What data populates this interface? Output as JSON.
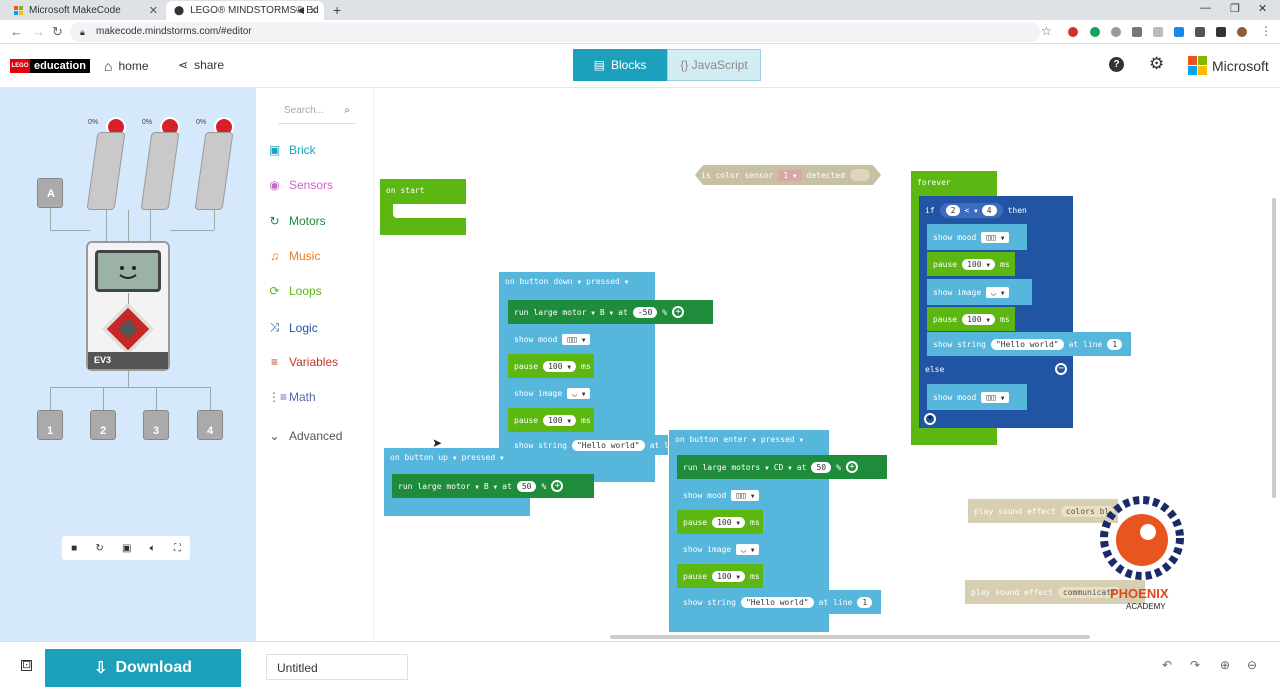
{
  "browser": {
    "tabs": [
      {
        "title": "Microsoft MakeCode",
        "active": false
      },
      {
        "title": "LEGO® MINDSTORMS® Ed",
        "active": true
      }
    ],
    "url": "makecode.mindstorms.com/#editor"
  },
  "header": {
    "brand_lego": "LEGO",
    "brand_education": "education",
    "home_label": "home",
    "share_label": "share",
    "blocks_label": "Blocks",
    "javascript_label": "{} JavaScript",
    "microsoft_label": "Microsoft"
  },
  "colors": {
    "brick": "#1ca0bc",
    "sensors": "#cf63cf",
    "motors": "#1e8c3a",
    "music": "#e67e22",
    "loops": "#5cb712",
    "logic": "#2155a3",
    "variables": "#c0392b",
    "math": "#5c68a6",
    "advanced": "#555555"
  },
  "simulator": {
    "motor_labels": [
      "0%",
      "0%",
      "0%"
    ],
    "motor_port": "A",
    "brick_label": "EV3",
    "sensor_ports": [
      "1",
      "2",
      "3",
      "4"
    ]
  },
  "toolbox": {
    "search_placeholder": "Search...",
    "categories": [
      {
        "label": "Brick",
        "icon": "brick-icon"
      },
      {
        "label": "Sensors",
        "icon": "sensors-icon"
      },
      {
        "label": "Motors",
        "icon": "motors-icon"
      },
      {
        "label": "Music",
        "icon": "headphones-icon"
      },
      {
        "label": "Loops",
        "icon": "loops-icon"
      },
      {
        "label": "Logic",
        "icon": "shuffle-icon"
      },
      {
        "label": "Variables",
        "icon": "list-icon"
      },
      {
        "label": "Math",
        "icon": "calculator-icon"
      },
      {
        "label": "Advanced",
        "icon": "chevron-down-icon"
      }
    ]
  },
  "blocks": {
    "on_start": "on start",
    "color_sensor": {
      "a": "is color sensor",
      "port": "1",
      "b": "detected"
    },
    "down": {
      "on_button": "on button",
      "button": "down",
      "event": "pressed",
      "run": "run",
      "motor": "large motor",
      "port": "B",
      "at": "at",
      "speed": "-50",
      "pct": "%",
      "show_mood": "show mood",
      "pause": "pause",
      "ms_val": "100",
      "ms": "ms",
      "show_image": "show image",
      "show_string": "show string",
      "str": "\"Hello world\"",
      "at_line": "at l"
    },
    "up": {
      "on_button": "on button",
      "button": "up",
      "event": "pressed",
      "run": "run",
      "motor": "large motor",
      "port": "B",
      "at": "at",
      "speed": "50",
      "pct": "%"
    },
    "enter": {
      "on_button": "on button",
      "button": "enter",
      "event": "pressed",
      "run": "run",
      "motor": "large motors",
      "port": "CD",
      "at": "at",
      "speed": "50",
      "pct": "%",
      "show_mood": "show mood",
      "pause": "pause",
      "ms_val": "100",
      "ms": "ms",
      "show_image": "show image",
      "show_string": "show string",
      "str": "\"Hello world\"",
      "at_line": "at line",
      "line": "1"
    },
    "forever": {
      "label": "forever",
      "if": "if",
      "a": "2",
      "op": "<",
      "b": "4",
      "then": "then",
      "show_mood": "show mood",
      "pause": "pause",
      "ms_val": "100",
      "ms": "ms",
      "show_image": "show image",
      "show_string": "show string",
      "str": "\"Hello world\"",
      "at_line": "at line",
      "line": "1",
      "else": "else"
    },
    "sound1": {
      "label": "play sound effect",
      "value": "colors bl"
    },
    "sound2": {
      "label": "play sound effect",
      "value": "communicati"
    }
  },
  "footer": {
    "download_label": "Download",
    "project_name": "Untitled"
  },
  "watermark": {
    "name": "PHOENIX",
    "sub": "ACADEMY"
  }
}
